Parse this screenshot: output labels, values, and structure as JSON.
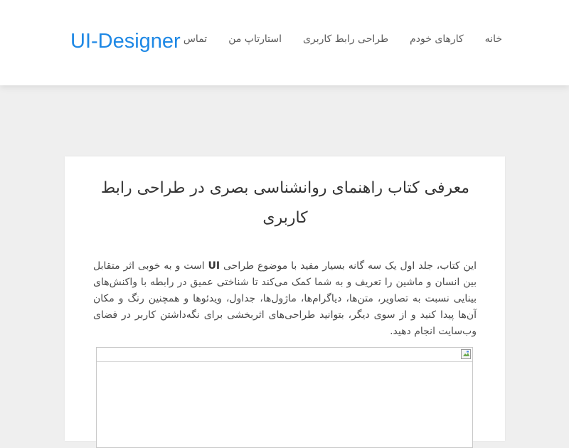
{
  "header": {
    "logo_text": "UI-Designer",
    "nav": [
      {
        "label": "خانه"
      },
      {
        "label": "کارهای خودم"
      },
      {
        "label": "طراحی رابط کاربری"
      },
      {
        "label": "استارتاپ من"
      },
      {
        "label": "تماس"
      }
    ]
  },
  "post": {
    "title": "معرفی کتاب راهنمای روانشناسی بصری در طراحی رابط کاربری",
    "body_part1": "این کتاب، جلد اول یک سه گانه بسیار مفید با موضوع طراحی ",
    "body_bold": "UI",
    "body_part2": " است و به خوبی اثر متقابل بین انسان و ماشین را تعریف و به شما کمک می‌کند تا شناختی عمیق در رابطه با واکنش‌های بینایی نسبت به تصاویر، متن‌ها، دیاگرام‌ها، ماژول‌ها، جداول، ویدئوها و همچنین رنگ و مکان آن‌ها پیدا کنید و از سوی دیگر، بتوانید طراحی‌های اثربخشی برای نگه‌داشتن کاربر در فضای وب‌سایت انجام دهید.",
    "image_icon": "broken-image-icon"
  },
  "colors": {
    "logo": "#1e88e5",
    "page_background": "#efefef"
  }
}
